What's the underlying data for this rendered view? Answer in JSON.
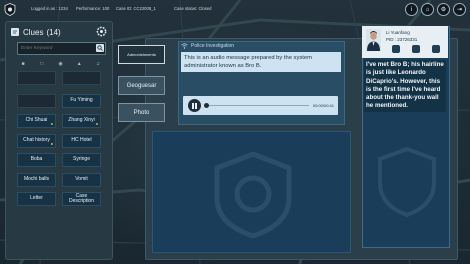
{
  "topbar": {
    "logged_in": "Logged in as : 1234",
    "performance": "Performance: 100",
    "case_id": "Case ID: CC22008_1",
    "case_status": "Case status: Closed",
    "icons": [
      "info-icon",
      "home-icon",
      "settings-icon",
      "exit-icon"
    ]
  },
  "clues": {
    "title": "Clues",
    "count": "(14)",
    "search_placeholder": "Enter Keyword",
    "filter_icons": [
      "person-icon",
      "document-icon",
      "location-icon",
      "item-icon",
      "audio-icon"
    ],
    "items": [
      {
        "label": ""
      },
      {
        "label": ""
      },
      {
        "label": ""
      },
      {
        "label": "Fu Yiming"
      },
      {
        "label": "Chi Shuai"
      },
      {
        "label": "Zhang Xinyi"
      },
      {
        "label": "Chat history"
      },
      {
        "label": "HC Hotel"
      },
      {
        "label": "Boba"
      },
      {
        "label": "Syringe"
      },
      {
        "label": "Mochi balls"
      },
      {
        "label": "Vomit"
      },
      {
        "label": "Letter"
      },
      {
        "label": "Case Description"
      }
    ]
  },
  "tabs": {
    "admonishments": "Admonishments",
    "geoguesser": "Geoguesar",
    "photo": "Photo"
  },
  "document": {
    "header": "Police Investigation",
    "text": "This is an audio message prepared by the system administrator known as Bro B.",
    "audio_time": "00:00/00:41"
  },
  "character": {
    "name": "Li Yuanfang",
    "pid": "PID : 23726331",
    "speech": "I've met Bro B; his hairline is just like Leonardo DiCaprio's. However, this is the first time I've heard about the thank-you wall he mentioned."
  },
  "colors": {
    "background": "#1d2a33",
    "panel": "#273a44",
    "clue_button": "#173244",
    "content_panel": "#1a3e5a",
    "text_light": "#cde3f1"
  }
}
